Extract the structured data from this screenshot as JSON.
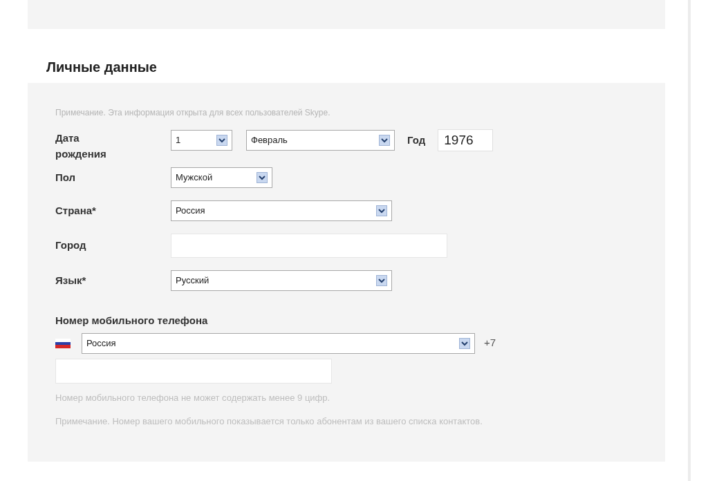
{
  "section": {
    "title": "Личные данные",
    "note": "Примечание. Эта информация открыта для всех пользователей Skype."
  },
  "birth_date": {
    "label": "Дата рождения",
    "day": "1",
    "month": "Февраль",
    "year_label": "Год",
    "year": "1976"
  },
  "fields": [
    {
      "kind": "select",
      "label": "Пол",
      "value": "Мужской"
    },
    {
      "kind": "select",
      "label": "Страна*",
      "value": "Россия"
    },
    {
      "kind": "input",
      "label": "Город"
    },
    {
      "kind": "select",
      "label": "Язык*",
      "value": "Русский"
    }
  ],
  "mobile": {
    "title": "Номер мобильного телефона",
    "country": "Россия",
    "code": "+7",
    "hint": "Номер мобильного телефона не может содержать менее 9 цифр.",
    "note": "Примечание. Номер вашего мобильного показывается только абонентам из вашего списка контактов."
  }
}
